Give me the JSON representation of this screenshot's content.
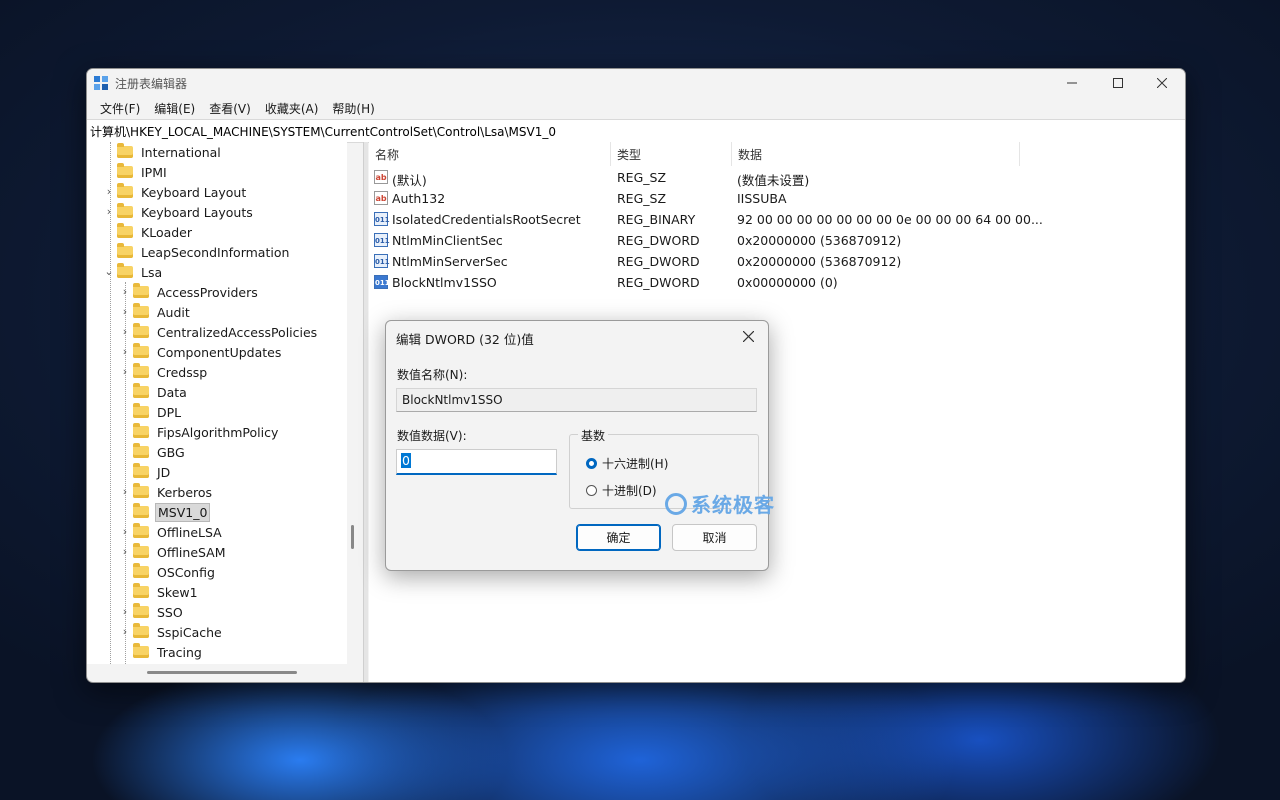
{
  "window": {
    "title": "注册表编辑器"
  },
  "menu": [
    "文件(F)",
    "编辑(E)",
    "查看(V)",
    "收藏夹(A)",
    "帮助(H)"
  ],
  "address": "计算机\\HKEY_LOCAL_MACHINE\\SYSTEM\\CurrentControlSet\\Control\\Lsa\\MSV1_0",
  "tree": {
    "items": [
      {
        "label": "International"
      },
      {
        "label": "IPMI"
      },
      {
        "label": "Keyboard Layout"
      },
      {
        "label": "Keyboard Layouts"
      },
      {
        "label": "KLoader"
      },
      {
        "label": "LeapSecondInformation"
      },
      {
        "label": "Lsa"
      },
      {
        "label": "AccessProviders"
      },
      {
        "label": "Audit"
      },
      {
        "label": "CentralizedAccessPolicies"
      },
      {
        "label": "ComponentUpdates"
      },
      {
        "label": "Credssp"
      },
      {
        "label": "Data"
      },
      {
        "label": "DPL"
      },
      {
        "label": "FipsAlgorithmPolicy"
      },
      {
        "label": "GBG"
      },
      {
        "label": "JD"
      },
      {
        "label": "Kerberos"
      },
      {
        "label": "MSV1_0"
      },
      {
        "label": "OfflineLSA"
      },
      {
        "label": "OfflineSAM"
      },
      {
        "label": "OSConfig"
      },
      {
        "label": "Skew1"
      },
      {
        "label": "SSO"
      },
      {
        "label": "SspiCache"
      },
      {
        "label": "Tracing"
      }
    ]
  },
  "list": {
    "columns": [
      "名称",
      "类型",
      "数据"
    ],
    "rows": [
      {
        "name": "(默认)",
        "type": "REG_SZ",
        "data": "(数值未设置)",
        "icon": "string-value-icon"
      },
      {
        "name": "Auth132",
        "type": "REG_SZ",
        "data": "IISSUBA",
        "icon": "string-value-icon"
      },
      {
        "name": "IsolatedCredentialsRootSecret",
        "type": "REG_BINARY",
        "data": "92 00 00 00 00 00 00 00 0e 00 00 00 64 00 00...",
        "icon": "binary-value-icon"
      },
      {
        "name": "NtlmMinClientSec",
        "type": "REG_DWORD",
        "data": "0x20000000 (536870912)",
        "icon": "binary-value-icon"
      },
      {
        "name": "NtlmMinServerSec",
        "type": "REG_DWORD",
        "data": "0x20000000 (536870912)",
        "icon": "binary-value-icon"
      },
      {
        "name": "BlockNtlmv1SSO",
        "type": "REG_DWORD",
        "data": "0x00000000 (0)",
        "icon": "binary-value-icon"
      }
    ]
  },
  "dialog": {
    "title": "编辑 DWORD (32 位)值",
    "name_label": "数值名称(N):",
    "name_value": "BlockNtlmv1SSO",
    "data_label": "数值数据(V):",
    "data_value": "0",
    "base_label": "基数",
    "radio_hex": "十六进制(H)",
    "radio_dec": "十进制(D)",
    "ok": "确定",
    "cancel": "取消"
  },
  "watermark": "系统极客"
}
